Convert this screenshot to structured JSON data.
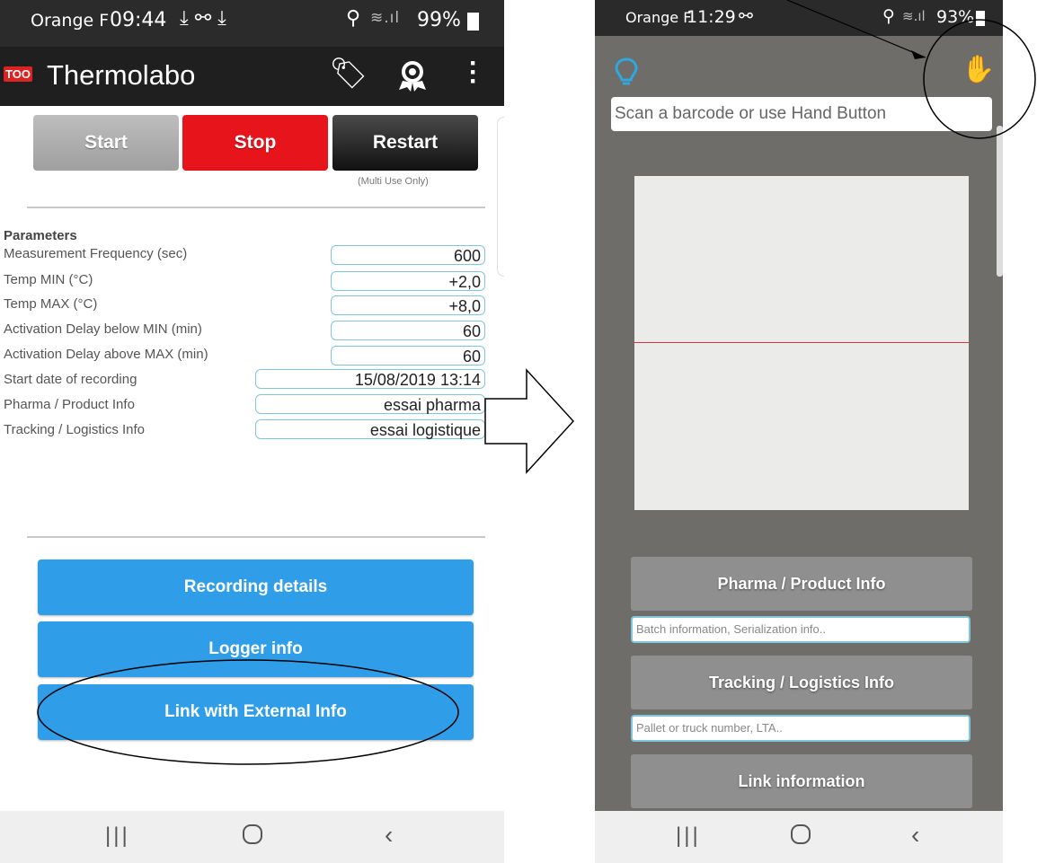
{
  "left_screen": {
    "status": {
      "carrier": "Orange F",
      "time": "09:44",
      "battery": "99%"
    },
    "app_title": "Thermolabo",
    "logo_text": "TOO",
    "buttons": {
      "start": "Start",
      "stop": "Stop",
      "restart": "Restart",
      "restart_note": "(Multi Use Only)"
    },
    "parameters": {
      "heading": "Parameters",
      "rows": [
        {
          "label": "Measurement Frequency (sec)",
          "value": "600"
        },
        {
          "label": "Temp MIN (°C)",
          "value": "+2,0"
        },
        {
          "label": "Temp MAX (°C)",
          "value": "+8,0"
        },
        {
          "label": "Activation Delay below MIN (min)",
          "value": "60"
        },
        {
          "label": "Activation Delay above MAX (min)",
          "value": "60"
        },
        {
          "label": "Start date of recording",
          "value": "15/08/2019 13:14"
        },
        {
          "label": "Pharma / Product Info",
          "value": "essai pharma"
        },
        {
          "label": "Tracking / Logistics Info",
          "value": "essai logistique"
        }
      ]
    },
    "actions": {
      "recording_details": "Recording details",
      "logger_info": "Logger info",
      "link_external": "Link with External Info"
    }
  },
  "right_screen": {
    "status": {
      "carrier": "Orange F",
      "time": "11:29",
      "battery": "93%"
    },
    "search_placeholder": "Scan a barcode or use Hand Button",
    "pharma_button": "Pharma / Product Info",
    "pharma_placeholder": "Batch information, Serialization info..",
    "tracking_button": "Tracking / Logistics Info",
    "tracking_placeholder": "Pallet or truck number, LTA..",
    "link_button": "Link information"
  },
  "colors": {
    "stop_red": "#e8141c",
    "action_blue": "#2f9de8",
    "input_border": "#7fc6d8",
    "icon_blue": "#2fa8e0"
  }
}
